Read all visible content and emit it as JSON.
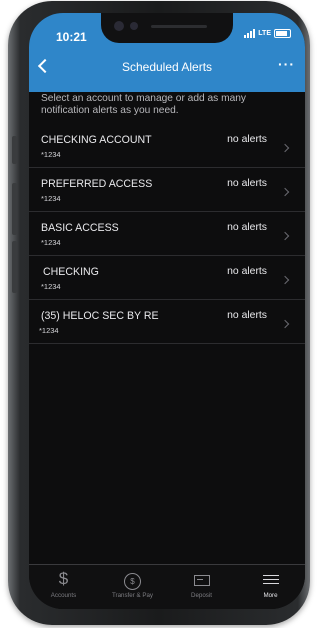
{
  "status_bar": {
    "time": "10:21",
    "network": "LTE"
  },
  "nav": {
    "title": "Scheduled Alerts",
    "back_icon": "chevron-left-icon",
    "more_icon": "more-dots-icon",
    "more_label": "···"
  },
  "intro": "Select an account to manage or add as many notification alerts as you need.",
  "accounts": [
    {
      "name": "CHECKING ACCOUNT",
      "number": "*1234",
      "alerts": "no alerts"
    },
    {
      "name": "PREFERRED ACCESS",
      "number": "*1234",
      "alerts": "no alerts"
    },
    {
      "name": "BASIC ACCESS",
      "number": "*1234",
      "alerts": "no alerts"
    },
    {
      "name": "CHECKING",
      "number": "*1234",
      "alerts": "no alerts"
    },
    {
      "name": "(35)  HELOC SEC BY RE",
      "number": "*1234",
      "alerts": "no alerts"
    }
  ],
  "tabbar": [
    {
      "label": "Accounts",
      "icon": "dollar-icon",
      "glyph": "$",
      "active": false
    },
    {
      "label": "Transfer & Pay",
      "icon": "transfer-pay-icon",
      "glyph": "$",
      "active": false
    },
    {
      "label": "Deposit",
      "icon": "deposit-check-icon",
      "active": false
    },
    {
      "label": "More",
      "icon": "menu-icon",
      "active": true
    }
  ],
  "colors": {
    "header": "#2f86c9",
    "background": "#0d0d0e"
  }
}
